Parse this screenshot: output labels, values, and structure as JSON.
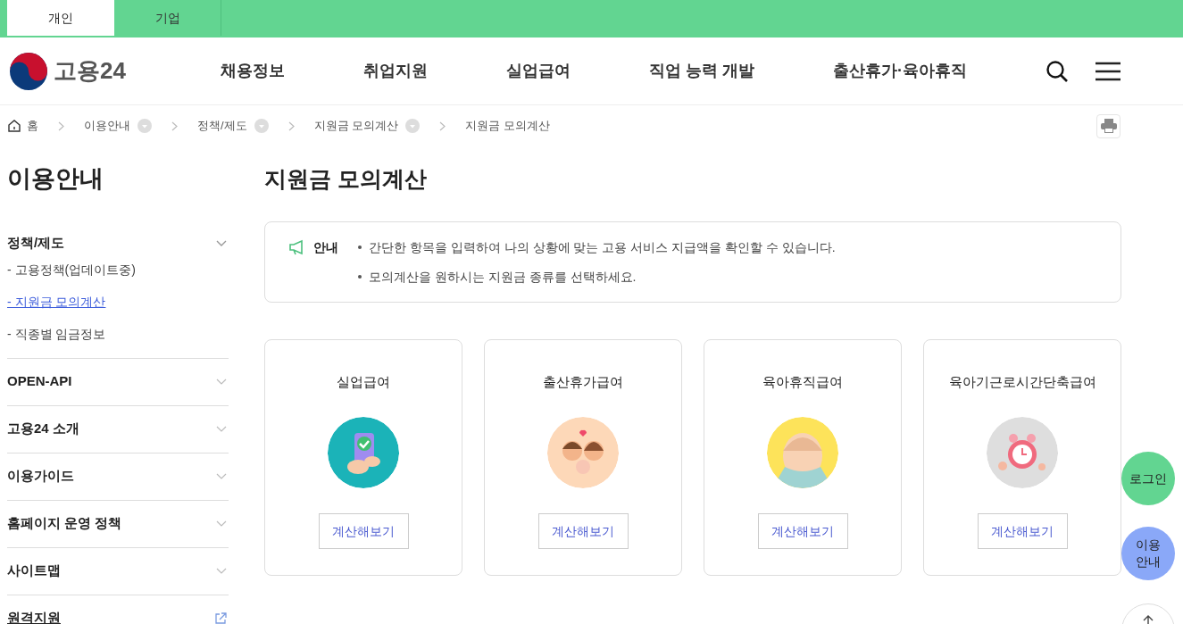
{
  "top_tabs": [
    {
      "label": "개인",
      "selected": true
    },
    {
      "label": "기업",
      "selected": false
    }
  ],
  "header": {
    "logo_text": "고용24",
    "nav": [
      "채용정보",
      "취업지원",
      "실업급여",
      "직업 능력 개발",
      "출산휴가·육아휴직"
    ]
  },
  "breadcrumb": [
    {
      "label": "홈",
      "kind": "home",
      "dropdown": false
    },
    {
      "label": "이용안내",
      "kind": "link",
      "dropdown": true
    },
    {
      "label": "정책/제도",
      "kind": "link",
      "dropdown": true
    },
    {
      "label": "지원금 모의계산",
      "kind": "link",
      "dropdown": true
    },
    {
      "label": "지원금 모의계산",
      "kind": "link",
      "dropdown": false
    }
  ],
  "sidebar": {
    "title": "이용안내",
    "items": [
      {
        "label": "정책/제도",
        "kind": "group",
        "expanded": true,
        "children": [
          {
            "label": "- 고용정책(업데이트중)",
            "selected": false
          },
          {
            "label": "- 지원금 모의계산",
            "selected": true
          },
          {
            "label": "- 직종별 임금정보",
            "selected": false
          }
        ]
      },
      {
        "label": "OPEN-API",
        "kind": "group",
        "expanded": false
      },
      {
        "label": "고용24 소개",
        "kind": "group",
        "expanded": false
      },
      {
        "label": "이용가이드",
        "kind": "group",
        "expanded": false
      },
      {
        "label": "홈페이지 운영 정책",
        "kind": "group",
        "expanded": false
      },
      {
        "label": "사이트맵",
        "kind": "group",
        "expanded": false
      },
      {
        "label": "원격지원",
        "kind": "external",
        "expanded": false
      }
    ]
  },
  "page_title": "지원금 모의계산",
  "notice": {
    "label": "안내",
    "lines": [
      "간단한 항목을 입력하여 나의 상황에 맞는 고용 서비스 지급액을 확인할 수 있습니다.",
      "모의계산을 원하시는 지원금 종류를 선택하세요."
    ]
  },
  "cards": [
    {
      "title": "실업급여",
      "button": "계산해보기",
      "color": "#1bb3b8"
    },
    {
      "title": "출산휴가급여",
      "button": "계산해보기",
      "color": "#fdd8b8"
    },
    {
      "title": "육아휴직급여",
      "button": "계산해보기",
      "color": "#fde35a"
    },
    {
      "title": "육아기근로시간단축급여",
      "button": "계산해보기",
      "color": "#dedede"
    }
  ],
  "floating": [
    {
      "label": "로그인",
      "color": "#62d591"
    },
    {
      "label": "이용\n안내",
      "color": "#8aa8f8"
    }
  ]
}
